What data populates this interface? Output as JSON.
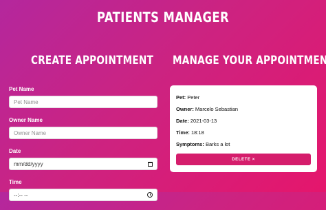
{
  "app": {
    "title": "PATIENTS MANAGER"
  },
  "create": {
    "heading": "CREATE APPOINTMENT",
    "pet_label": "Pet Name",
    "pet_placeholder": "Pet Name",
    "owner_label": "Owner Name",
    "owner_placeholder": "Owner Name",
    "date_label": "Date",
    "date_placeholder": "mm/dd/yyyy",
    "time_label": "Time",
    "time_placeholder": "--:-- --"
  },
  "manage": {
    "heading": "MANAGE YOUR APPOINTMENTS",
    "appointment": {
      "pet_label": "Pet:",
      "pet": "Peter",
      "owner_label": "Owner:",
      "owner": "Marcelo Sebastian",
      "date_label": "Date:",
      "date": "2021-03-13",
      "time_label": "Time:",
      "time": "18:18",
      "symptoms_label": "Symptoms:",
      "symptoms": "Barks a lot",
      "delete_label": "DELETE ×"
    }
  },
  "icons": {
    "date": "calendar-icon",
    "time": "clock-icon"
  },
  "colors": {
    "gradient_start": "#b4279d",
    "gradient_end": "#e5166c",
    "delete_button": "#d51d6c"
  }
}
